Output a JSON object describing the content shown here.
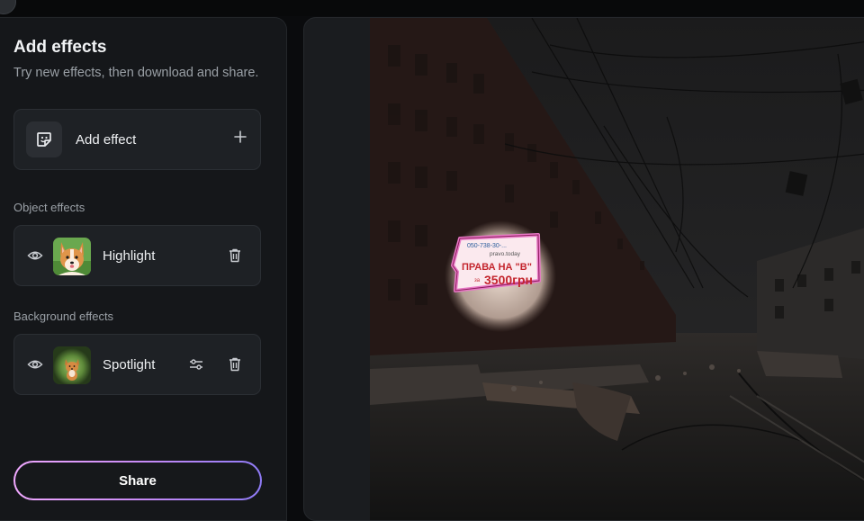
{
  "panel": {
    "title": "Add effects",
    "subtitle": "Try new effects, then download and share.",
    "add_effect": {
      "label": "Add effect",
      "icon": "sticker-icon"
    },
    "object_section": "Object effects",
    "object_effects": [
      {
        "label": "Highlight",
        "thumb": "corgi-portrait"
      }
    ],
    "background_section": "Background effects",
    "background_effects": [
      {
        "label": "Spotlight",
        "thumb": "corgi-on-grass"
      }
    ],
    "share_label": "Share"
  },
  "canvas": {
    "sign": {
      "phone": "050-738-30-...",
      "site": "pravo.today",
      "line1": "ПРАВА НА \"В\"",
      "price_prefix": "за",
      "price": "3500грн"
    }
  },
  "colors": {
    "panel_bg": "#15171a",
    "card_bg": "#1e2125",
    "accent_gradient_start": "#f0a8ff",
    "accent_gradient_end": "#8f7bf7",
    "highlight_pink": "#e879c6"
  }
}
